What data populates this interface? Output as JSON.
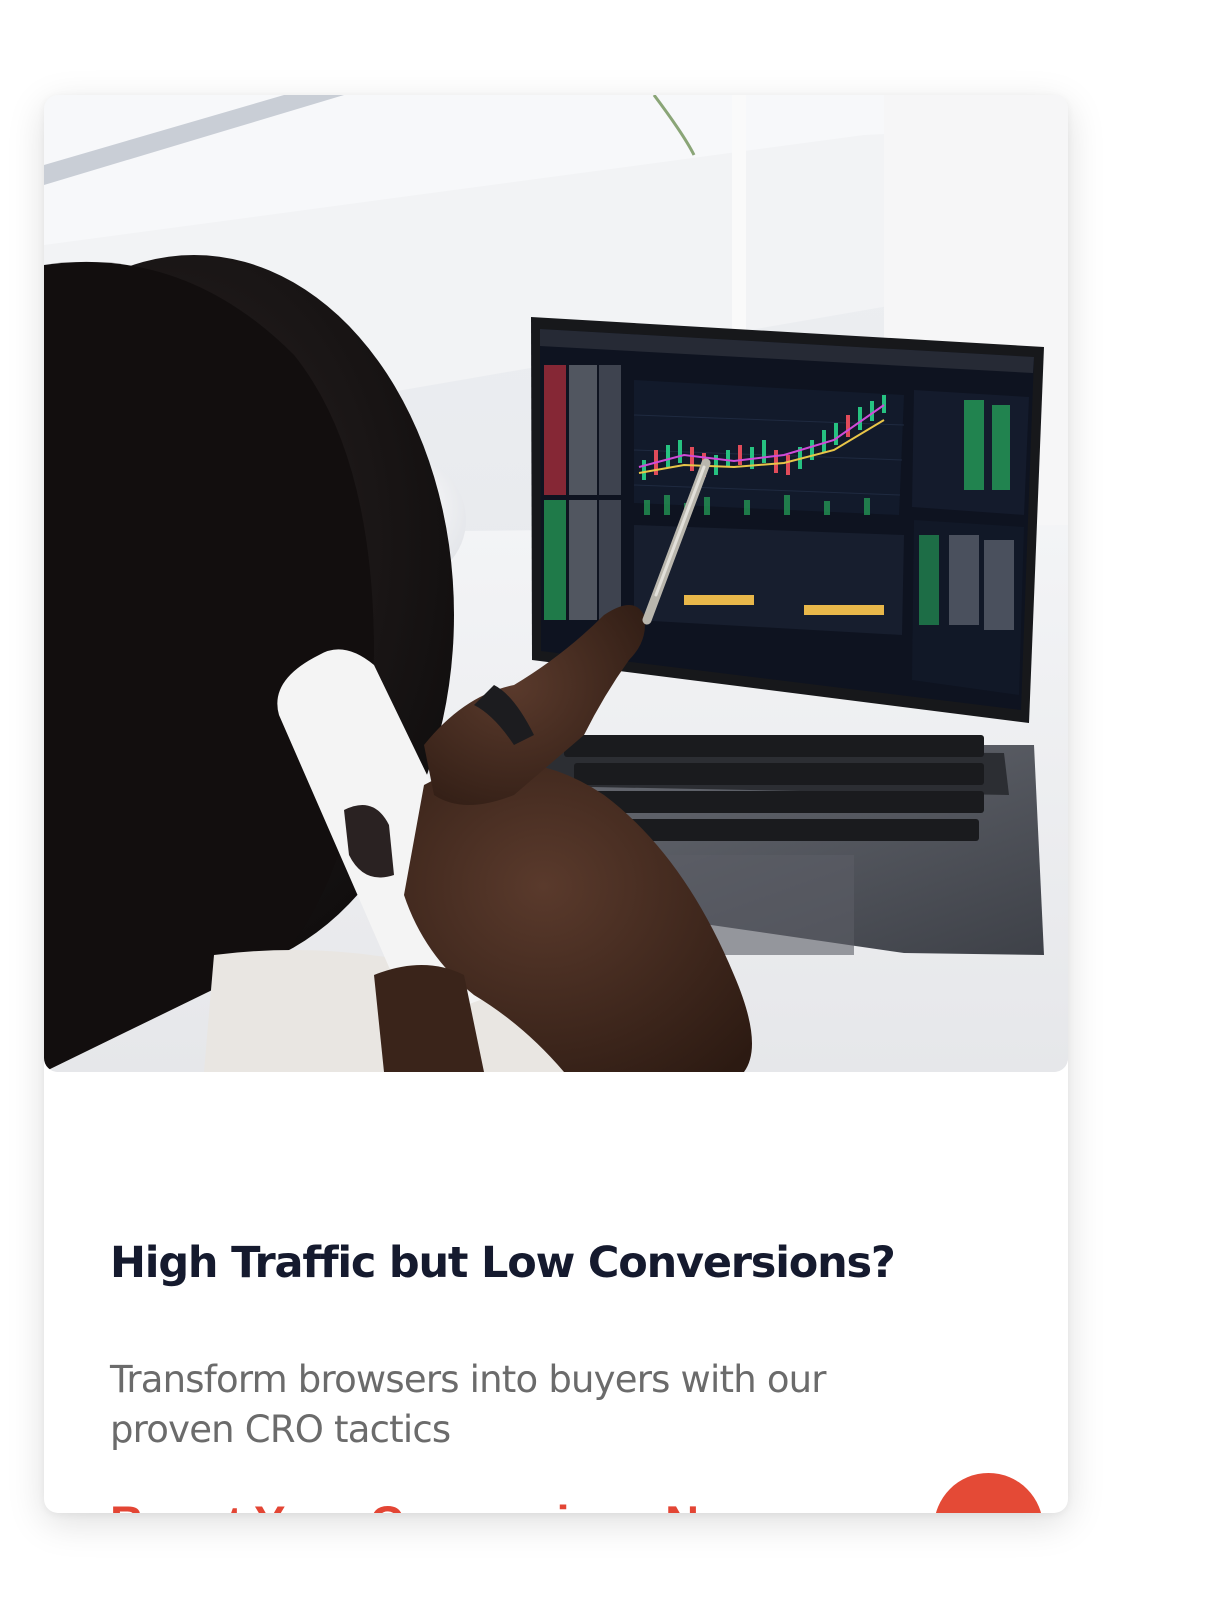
{
  "card": {
    "image_alt": "Person on phone pointing a pen at a trading chart on a laptop",
    "title": "High Traffic but Low Conversions?",
    "description": "Transform browsers into buyers with our proven CRO tactics",
    "cta_label": "Boost Your Conversions Now",
    "cta_icon": "arrow-right-icon"
  },
  "colors": {
    "accent": "#e44a36",
    "title": "#151a2e",
    "body_text": "#6b6b6b"
  }
}
